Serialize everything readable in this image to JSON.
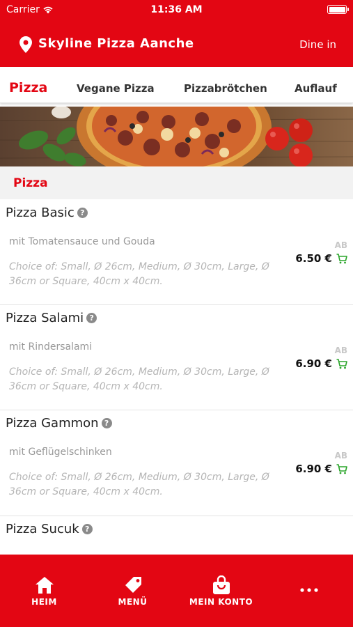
{
  "status_bar": {
    "carrier": "Carrier",
    "time": "11:36 AM"
  },
  "header": {
    "shop_name": "Skyline Pizza Aanche",
    "mode": "Dine in",
    "accent": "#e30613"
  },
  "tabs": [
    {
      "label": "Pizza",
      "active": true
    },
    {
      "label": "Vegane Pizza",
      "active": false
    },
    {
      "label": "Pizzabrötchen",
      "active": false
    },
    {
      "label": "Auflauf",
      "active": false
    }
  ],
  "section": {
    "title": "Pizza"
  },
  "items": [
    {
      "name": "Pizza Basic",
      "description": "mit Tomatensauce und Gouda",
      "choice": "Choice of: Small, Ø 26cm, Medium, Ø 30cm, Large, Ø 36cm or Square, 40cm x 40cm.",
      "ab": "AB",
      "price": "6.50 €"
    },
    {
      "name": "Pizza Salami",
      "description": "mit Rindersalami",
      "choice": "Choice of: Small, Ø 26cm, Medium, Ø 30cm, Large, Ø 36cm or Square, 40cm x 40cm.",
      "ab": "AB",
      "price": "6.90 €"
    },
    {
      "name": "Pizza Gammon",
      "description": "mit Geflügelschinken",
      "choice": "Choice of: Small, Ø 26cm, Medium, Ø 30cm, Large, Ø 36cm or Square, 40cm x 40cm.",
      "ab": "AB",
      "price": "6.90 €"
    },
    {
      "name": "Pizza Sucuk"
    }
  ],
  "bottom_nav": [
    {
      "label": "HEIM",
      "icon": "home-icon"
    },
    {
      "label": "MENÜ",
      "icon": "tag-icon"
    },
    {
      "label": "MEIN KONTO",
      "icon": "bag-icon"
    },
    {
      "label": "",
      "icon": "more-icon"
    }
  ]
}
